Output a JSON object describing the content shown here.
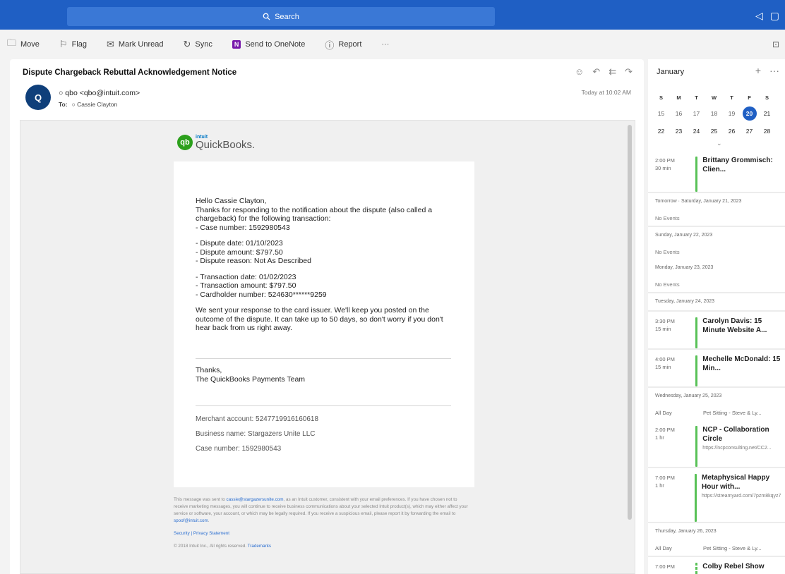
{
  "topbar": {
    "search_label": "Search"
  },
  "toolbar": {
    "move": "Move",
    "flag": "Flag",
    "mark_unread": "Mark Unread",
    "sync": "Sync",
    "send_onenote": "Send to OneNote",
    "report": "Report",
    "more": "···"
  },
  "message": {
    "subject": "Dispute Chargeback Rebuttal Acknowledgement Notice",
    "avatar_initial": "Q",
    "from": "qbo <qbo@intuit.com>",
    "to_label": "To:",
    "to": "Cassie Clayton",
    "time": "Today at 10:02 AM"
  },
  "email": {
    "logo_intuit": "intuit",
    "logo_name": "QuickBooks.",
    "logo_mark": "qb",
    "greeting": "Hello Cassie Clayton,",
    "intro": "Thanks for responding to the notification about the dispute (also called a chargeback) for the following transaction:",
    "case_line": "- Case number: 1592980543",
    "dispute_date": "- Dispute date: 01/10/2023",
    "dispute_amount": "- Dispute amount: $797.50",
    "dispute_reason": "- Dispute reason: Not As Described",
    "txn_date": "- Transaction date: 01/02/2023",
    "txn_amount": "- Transaction amount: $797.50",
    "cardholder": "- Cardholder number: 524630******9259",
    "response": "We sent your response to the card issuer. We'll keep you posted on the outcome of the dispute. It can take up to 50 days, so don't worry if you don't hear back from us right away.",
    "thanks": "Thanks,",
    "team": "The QuickBooks Payments Team",
    "merchant_account": "Merchant account: 5247719916160618",
    "business_name": "Business name: Stargazers Unite LLC",
    "case_number": "Case number: 1592980543"
  },
  "footer": {
    "p1_a": "This message was sent to",
    "p1_email": "cassie@stargazersunite.com",
    "p1_b": ", as an Intuit customer, consistent with your email preferences. If you have chosen not to receive marketing messages, you will continue to receive business communications about your selected Intuit product(s), which may either affect your service or software, your account, or which may be legally required. If you receive a suspicious email, please report it by forwarding the email to",
    "p1_spoof": "spoof@intuit.com",
    "p1_end": ".",
    "links": "Security | Privacy Statement",
    "copyright": "© 2018 Intuit Inc., All rights reserved.",
    "trademarks": "Trademarks"
  },
  "calendar": {
    "month": "January",
    "weekdays": [
      "S",
      "M",
      "T",
      "W",
      "T",
      "F",
      "S"
    ],
    "week1": [
      "15",
      "16",
      "17",
      "18",
      "19",
      "20",
      "21"
    ],
    "week2": [
      "22",
      "23",
      "24",
      "25",
      "26",
      "27",
      "28"
    ],
    "today": "20",
    "agenda": {
      "ev1_time": "2:00 PM",
      "ev1_dur": "30 min",
      "ev1_title": "Brittany Grommisch: Clien...",
      "day_tomorrow": "Tomorrow · Saturday, January 21, 2023",
      "no_events_1": "No Events",
      "day_22": "Sunday, January 22, 2023",
      "no_events_2": "No Events",
      "day_23": "Monday, January 23, 2023",
      "no_events_3": "No Events",
      "day_24": "Tuesday, January 24, 2023",
      "ev2_time": "3:30 PM",
      "ev2_dur": "15 min",
      "ev2_title": "Carolyn Davis: 15 Minute Website A...",
      "ev3_time": "4:00 PM",
      "ev3_dur": "15 min",
      "ev3_title": "Mechelle McDonald: 15 Min...",
      "day_25": "Wednesday, January 25, 2023",
      "allday_label_1": "All Day",
      "allday_1": "Pet Sitting - Steve & Ly...",
      "ev4_time": "2:00 PM",
      "ev4_dur": "1 hr",
      "ev4_title": "NCP - Collaboration Circle",
      "ev4_sub": "https://ncpconsulting.net/CC2...",
      "ev5_time": "7:00 PM",
      "ev5_dur": "1 hr",
      "ev5_title": "Metaphysical Happy Hour with...",
      "ev5_sub": "https://streamyard.com/7pzm8kqyz7",
      "day_26": "Thursday, January 26, 2023",
      "allday_label_2": "All Day",
      "allday_2": "Pet Sitting - Steve & Ly...",
      "ev6_time": "7:00 PM",
      "ev6_title": "Colby Rebel Show"
    }
  },
  "colors": {
    "accent": "#1f5fc4",
    "event_green": "#58c157",
    "qb_green": "#2ca01c"
  }
}
